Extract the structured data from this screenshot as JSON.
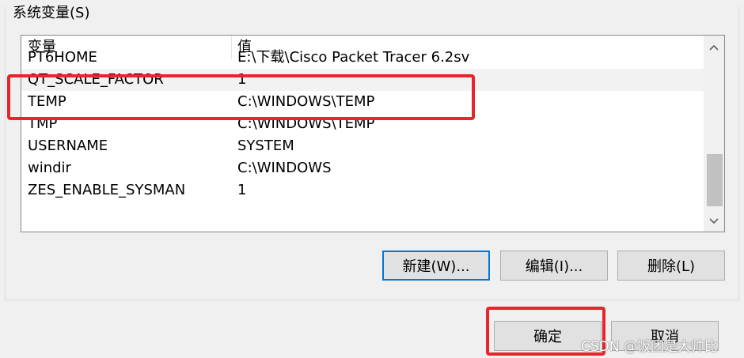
{
  "group": {
    "title": "系统变量(S)"
  },
  "table": {
    "columns": [
      "变量",
      "值"
    ],
    "rows": [
      {
        "name": "PT6HOME",
        "value": "E:\\下载\\Cisco Packet Tracer 6.2sv"
      },
      {
        "name": "QT_SCALE_FACTOR",
        "value": "1",
        "selected": true
      },
      {
        "name": "TEMP",
        "value": "C:\\WINDOWS\\TEMP"
      },
      {
        "name": "TMP",
        "value": "C:\\WINDOWS\\TEMP"
      },
      {
        "name": "USERNAME",
        "value": "SYSTEM"
      },
      {
        "name": "windir",
        "value": "C:\\WINDOWS"
      },
      {
        "name": "ZES_ENABLE_SYSMAN",
        "value": "1"
      }
    ]
  },
  "scrollbar": {
    "up_icon": "chevron-up-icon",
    "down_icon": "chevron-down-icon"
  },
  "buttons": {
    "new": "新建(W)...",
    "edit": "编辑(I)...",
    "delete": "删除(L)",
    "ok": "确定",
    "cancel": "取消"
  },
  "watermark": "CSDN @饭团是大帅比",
  "colors": {
    "highlight": "#e8242c",
    "default_button_border": "#0078d7"
  }
}
